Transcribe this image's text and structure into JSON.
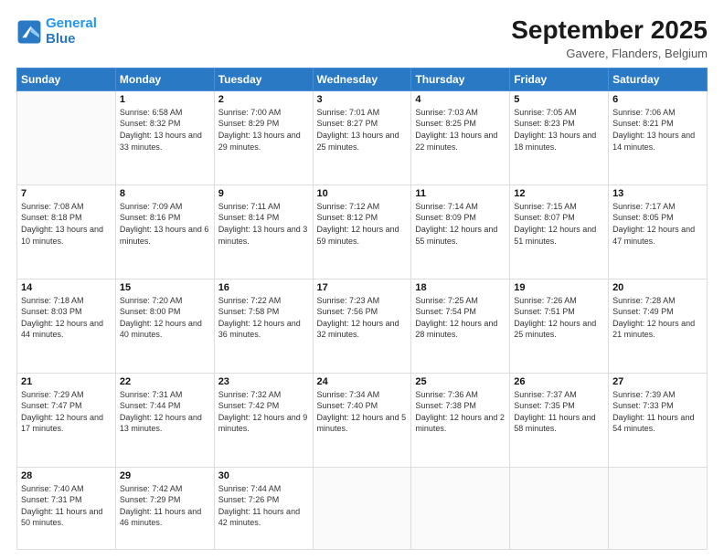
{
  "logo": {
    "line1": "General",
    "line2": "Blue"
  },
  "title": "September 2025",
  "subtitle": "Gavere, Flanders, Belgium",
  "days_of_week": [
    "Sunday",
    "Monday",
    "Tuesday",
    "Wednesday",
    "Thursday",
    "Friday",
    "Saturday"
  ],
  "weeks": [
    [
      {
        "day": "",
        "sunrise": "",
        "sunset": "",
        "daylight": ""
      },
      {
        "day": "1",
        "sunrise": "Sunrise: 6:58 AM",
        "sunset": "Sunset: 8:32 PM",
        "daylight": "Daylight: 13 hours and 33 minutes."
      },
      {
        "day": "2",
        "sunrise": "Sunrise: 7:00 AM",
        "sunset": "Sunset: 8:29 PM",
        "daylight": "Daylight: 13 hours and 29 minutes."
      },
      {
        "day": "3",
        "sunrise": "Sunrise: 7:01 AM",
        "sunset": "Sunset: 8:27 PM",
        "daylight": "Daylight: 13 hours and 25 minutes."
      },
      {
        "day": "4",
        "sunrise": "Sunrise: 7:03 AM",
        "sunset": "Sunset: 8:25 PM",
        "daylight": "Daylight: 13 hours and 22 minutes."
      },
      {
        "day": "5",
        "sunrise": "Sunrise: 7:05 AM",
        "sunset": "Sunset: 8:23 PM",
        "daylight": "Daylight: 13 hours and 18 minutes."
      },
      {
        "day": "6",
        "sunrise": "Sunrise: 7:06 AM",
        "sunset": "Sunset: 8:21 PM",
        "daylight": "Daylight: 13 hours and 14 minutes."
      }
    ],
    [
      {
        "day": "7",
        "sunrise": "Sunrise: 7:08 AM",
        "sunset": "Sunset: 8:18 PM",
        "daylight": "Daylight: 13 hours and 10 minutes."
      },
      {
        "day": "8",
        "sunrise": "Sunrise: 7:09 AM",
        "sunset": "Sunset: 8:16 PM",
        "daylight": "Daylight: 13 hours and 6 minutes."
      },
      {
        "day": "9",
        "sunrise": "Sunrise: 7:11 AM",
        "sunset": "Sunset: 8:14 PM",
        "daylight": "Daylight: 13 hours and 3 minutes."
      },
      {
        "day": "10",
        "sunrise": "Sunrise: 7:12 AM",
        "sunset": "Sunset: 8:12 PM",
        "daylight": "Daylight: 12 hours and 59 minutes."
      },
      {
        "day": "11",
        "sunrise": "Sunrise: 7:14 AM",
        "sunset": "Sunset: 8:09 PM",
        "daylight": "Daylight: 12 hours and 55 minutes."
      },
      {
        "day": "12",
        "sunrise": "Sunrise: 7:15 AM",
        "sunset": "Sunset: 8:07 PM",
        "daylight": "Daylight: 12 hours and 51 minutes."
      },
      {
        "day": "13",
        "sunrise": "Sunrise: 7:17 AM",
        "sunset": "Sunset: 8:05 PM",
        "daylight": "Daylight: 12 hours and 47 minutes."
      }
    ],
    [
      {
        "day": "14",
        "sunrise": "Sunrise: 7:18 AM",
        "sunset": "Sunset: 8:03 PM",
        "daylight": "Daylight: 12 hours and 44 minutes."
      },
      {
        "day": "15",
        "sunrise": "Sunrise: 7:20 AM",
        "sunset": "Sunset: 8:00 PM",
        "daylight": "Daylight: 12 hours and 40 minutes."
      },
      {
        "day": "16",
        "sunrise": "Sunrise: 7:22 AM",
        "sunset": "Sunset: 7:58 PM",
        "daylight": "Daylight: 12 hours and 36 minutes."
      },
      {
        "day": "17",
        "sunrise": "Sunrise: 7:23 AM",
        "sunset": "Sunset: 7:56 PM",
        "daylight": "Daylight: 12 hours and 32 minutes."
      },
      {
        "day": "18",
        "sunrise": "Sunrise: 7:25 AM",
        "sunset": "Sunset: 7:54 PM",
        "daylight": "Daylight: 12 hours and 28 minutes."
      },
      {
        "day": "19",
        "sunrise": "Sunrise: 7:26 AM",
        "sunset": "Sunset: 7:51 PM",
        "daylight": "Daylight: 12 hours and 25 minutes."
      },
      {
        "day": "20",
        "sunrise": "Sunrise: 7:28 AM",
        "sunset": "Sunset: 7:49 PM",
        "daylight": "Daylight: 12 hours and 21 minutes."
      }
    ],
    [
      {
        "day": "21",
        "sunrise": "Sunrise: 7:29 AM",
        "sunset": "Sunset: 7:47 PM",
        "daylight": "Daylight: 12 hours and 17 minutes."
      },
      {
        "day": "22",
        "sunrise": "Sunrise: 7:31 AM",
        "sunset": "Sunset: 7:44 PM",
        "daylight": "Daylight: 12 hours and 13 minutes."
      },
      {
        "day": "23",
        "sunrise": "Sunrise: 7:32 AM",
        "sunset": "Sunset: 7:42 PM",
        "daylight": "Daylight: 12 hours and 9 minutes."
      },
      {
        "day": "24",
        "sunrise": "Sunrise: 7:34 AM",
        "sunset": "Sunset: 7:40 PM",
        "daylight": "Daylight: 12 hours and 5 minutes."
      },
      {
        "day": "25",
        "sunrise": "Sunrise: 7:36 AM",
        "sunset": "Sunset: 7:38 PM",
        "daylight": "Daylight: 12 hours and 2 minutes."
      },
      {
        "day": "26",
        "sunrise": "Sunrise: 7:37 AM",
        "sunset": "Sunset: 7:35 PM",
        "daylight": "Daylight: 11 hours and 58 minutes."
      },
      {
        "day": "27",
        "sunrise": "Sunrise: 7:39 AM",
        "sunset": "Sunset: 7:33 PM",
        "daylight": "Daylight: 11 hours and 54 minutes."
      }
    ],
    [
      {
        "day": "28",
        "sunrise": "Sunrise: 7:40 AM",
        "sunset": "Sunset: 7:31 PM",
        "daylight": "Daylight: 11 hours and 50 minutes."
      },
      {
        "day": "29",
        "sunrise": "Sunrise: 7:42 AM",
        "sunset": "Sunset: 7:29 PM",
        "daylight": "Daylight: 11 hours and 46 minutes."
      },
      {
        "day": "30",
        "sunrise": "Sunrise: 7:44 AM",
        "sunset": "Sunset: 7:26 PM",
        "daylight": "Daylight: 11 hours and 42 minutes."
      },
      {
        "day": "",
        "sunrise": "",
        "sunset": "",
        "daylight": ""
      },
      {
        "day": "",
        "sunrise": "",
        "sunset": "",
        "daylight": ""
      },
      {
        "day": "",
        "sunrise": "",
        "sunset": "",
        "daylight": ""
      },
      {
        "day": "",
        "sunrise": "",
        "sunset": "",
        "daylight": ""
      }
    ]
  ]
}
